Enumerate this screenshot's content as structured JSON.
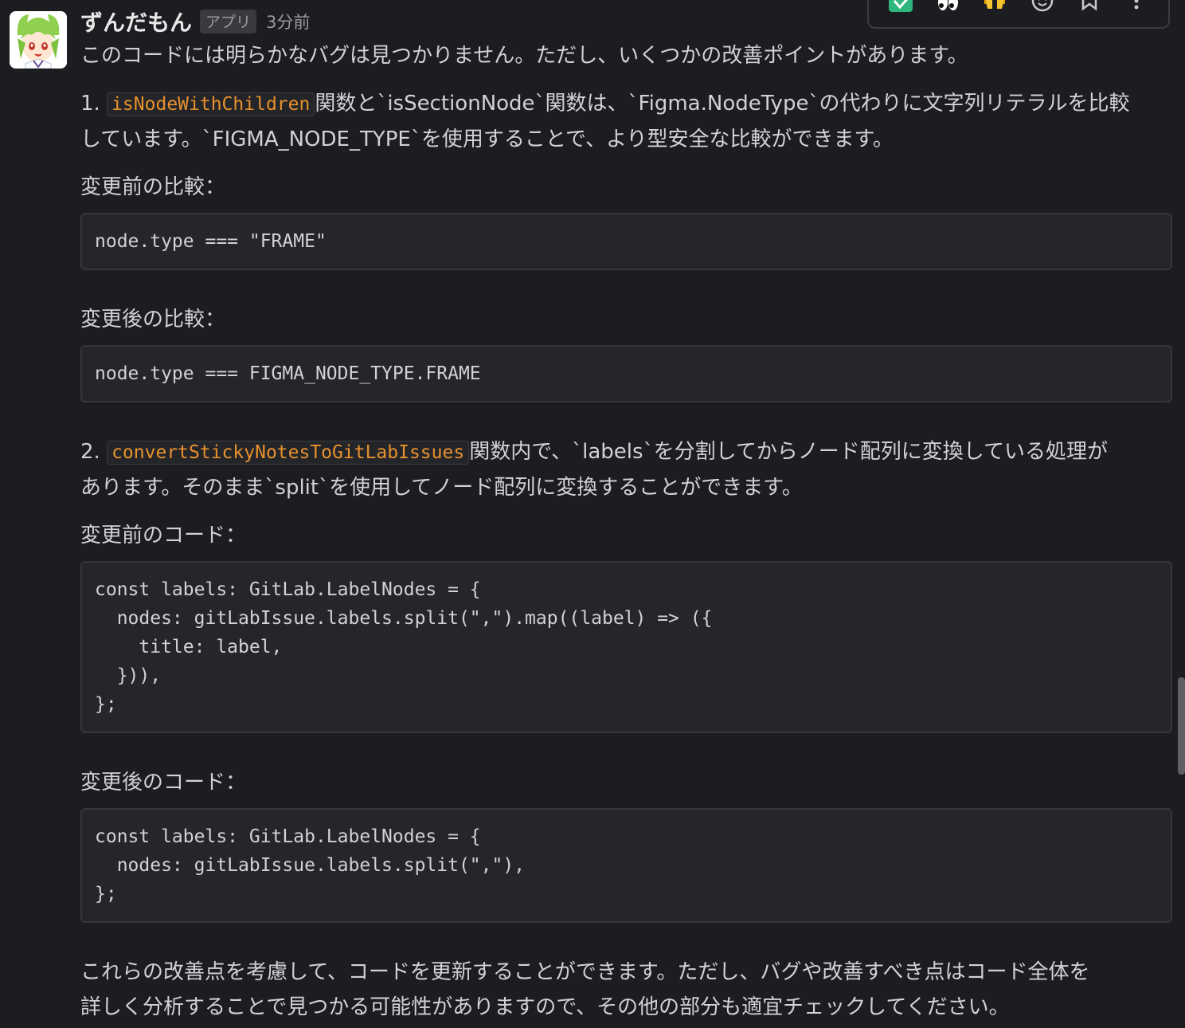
{
  "message": {
    "sender": "ずんだもん",
    "badge": "アプリ",
    "time": "3分前",
    "intro": "このコードには明らかなバグは見つかりません。ただし、いくつかの改善ポイントがあります。",
    "item1": {
      "number": "1.",
      "code": "isNodeWithChildren",
      "line1_after": "関数と`isSectionNode`関数は、`Figma.NodeType`の代わりに文字列リテラルを比較",
      "line2": "しています。`FIGMA_NODE_TYPE`を使用することで、より型安全な比較ができます。",
      "before_label": "変更前の比較：",
      "before_code": "node.type === \"FRAME\"",
      "after_label": "変更後の比較：",
      "after_code": "node.type === FIGMA_NODE_TYPE.FRAME"
    },
    "item2": {
      "number": "2.",
      "code": "convertStickyNotesToGitLabIssues",
      "line1_after": "関数内で、`labels`を分割してからノード配列に変換している処理が",
      "line2": "あります。そのまま`split`を使用してノード配列に変換することができます。",
      "before_label": "変更前のコード：",
      "before_code": "const labels: GitLab.LabelNodes = {\n  nodes: gitLabIssue.labels.split(\",\").map((label) => ({\n    title: label,\n  })),\n};",
      "after_label": "変更後のコード：",
      "after_code": "const labels: GitLab.LabelNodes = {\n  nodes: gitLabIssue.labels.split(\",\"),\n};"
    },
    "outro_line1": "これらの改善点を考慮して、コードを更新することができます。ただし、バグや改善すべき点はコード全体を",
    "outro_line2": "詳しく分析することで見つかる可能性がありますので、その他の部分も適宜チェックしてください。"
  },
  "toolbar": {
    "icons": [
      "check-reaction-icon",
      "eyes-reaction-icon",
      "raised-hands-reaction-icon",
      "add-reaction-icon",
      "bookmark-icon",
      "more-actions-icon"
    ]
  },
  "colors": {
    "background": "#1b1d21",
    "text": "#d1d2d3",
    "inline_code": "#e8912d",
    "code_block_bg": "#24262a",
    "avatar_hair": "#8fd14f"
  }
}
